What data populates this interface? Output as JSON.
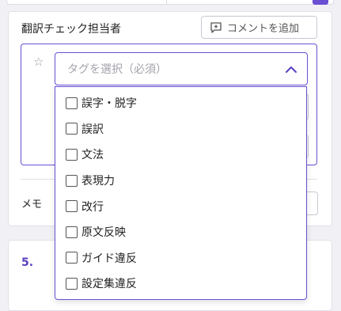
{
  "section": {
    "title": "翻訳チェック担当者",
    "comment_button": "コメントを追加"
  },
  "select": {
    "placeholder": "タグを選択（必須）",
    "options": [
      "誤字・脱字",
      "誤訳",
      "文法",
      "表現力",
      "改行",
      "原文反映",
      "ガイド違反",
      "設定集違反"
    ]
  },
  "memo": {
    "label": "メモ"
  },
  "next_item": {
    "number": "5."
  },
  "colors": {
    "accent": "#6a4fd3",
    "icons": [
      "star-outline-icon",
      "comment-plus-icon",
      "chevron-up-icon"
    ]
  }
}
